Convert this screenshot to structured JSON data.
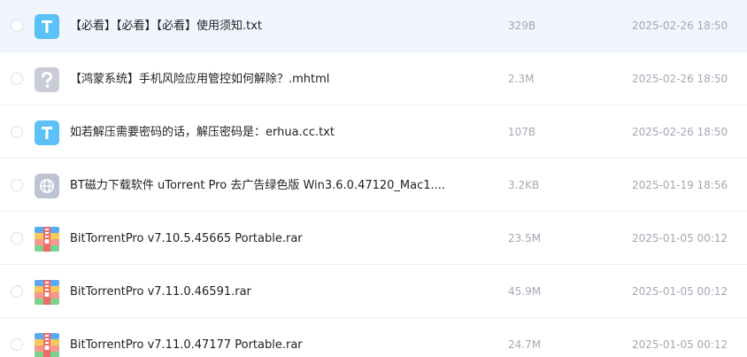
{
  "files": [
    {
      "name": "【必看】【必看】【必看】使用须知.txt",
      "size": "329B",
      "date": "2025-02-26 18:50",
      "icon": "txt-file-icon",
      "selected": true
    },
    {
      "name": "【鸿蒙系统】手机风险应用管控如何解除？.mhtml",
      "size": "2.3M",
      "date": "2025-02-26 18:50",
      "icon": "unknown-file-icon",
      "selected": false
    },
    {
      "name": "如若解压需要密码的话，解压密码是：erhua.cc.txt",
      "size": "107B",
      "date": "2025-02-26 18:50",
      "icon": "txt-file-icon",
      "selected": false
    },
    {
      "name": "BT磁力下载软件 uTorrent Pro 去广告绿色版 Win3.6.0.47120_Mac1....",
      "size": "3.2KB",
      "date": "2025-01-19 18:56",
      "icon": "link-file-icon",
      "selected": false
    },
    {
      "name": "BitTorrentPro v7.10.5.45665 Portable.rar",
      "size": "23.5M",
      "date": "2025-01-05 00:12",
      "icon": "archive-file-icon",
      "selected": false
    },
    {
      "name": "BitTorrentPro v7.11.0.46591.rar",
      "size": "45.9M",
      "date": "2025-01-05 00:12",
      "icon": "archive-file-icon",
      "selected": false
    },
    {
      "name": "BitTorrentPro v7.11.0.47177 Portable.rar",
      "size": "24.7M",
      "date": "2025-01-05 00:12",
      "icon": "archive-file-icon",
      "selected": false
    }
  ],
  "colors": {
    "selected_row": "#f1f5fe",
    "txt_icon": "#5cc1f6",
    "unknown_icon": "#c9ccd6",
    "link_icon": "#bcc3d3",
    "meta_text": "#a3a8b3"
  }
}
